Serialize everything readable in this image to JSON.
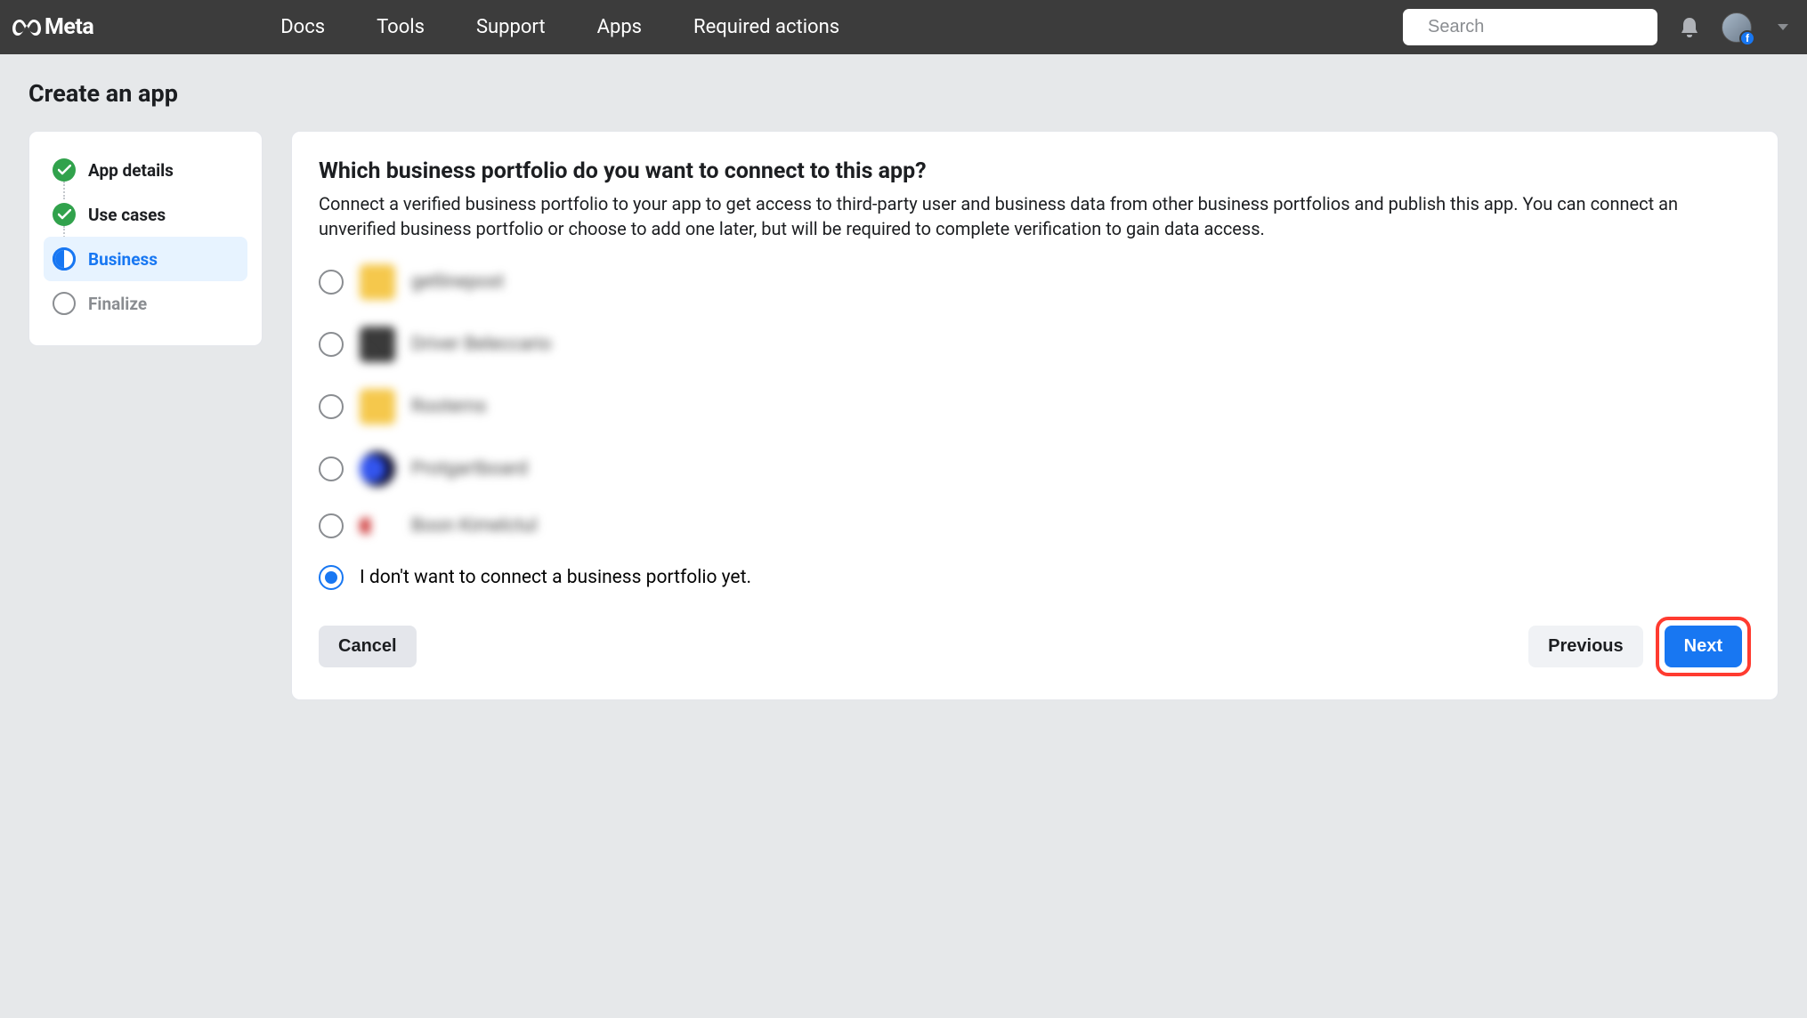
{
  "header": {
    "brand": "Meta",
    "nav": {
      "docs": "Docs",
      "tools": "Tools",
      "support": "Support",
      "apps": "Apps",
      "required_actions": "Required actions"
    },
    "search_placeholder": "Search"
  },
  "page": {
    "title": "Create an app"
  },
  "steps": {
    "app_details": "App details",
    "use_cases": "Use cases",
    "business": "Business",
    "finalize": "Finalize"
  },
  "main": {
    "heading": "Which business portfolio do you want to connect to this app?",
    "description": "Connect a verified business portfolio to your app to get access to third-party user and business data from other business portfolios and publish this app. You can connect an unverified business portfolio or choose to add one later, but will be required to complete verification to gain data access.",
    "options": [
      {
        "label": "getlinepost",
        "selected": false,
        "blurred": true,
        "icon": "c1"
      },
      {
        "label": "Driver Beleccario",
        "selected": false,
        "blurred": true,
        "icon": "c2"
      },
      {
        "label": "Rooterns",
        "selected": false,
        "blurred": true,
        "icon": "c3"
      },
      {
        "label": "Protgartboard",
        "selected": false,
        "blurred": true,
        "icon": "c4"
      },
      {
        "label": "Boon Kimelctul",
        "selected": false,
        "blurred": true,
        "icon": "c5"
      }
    ],
    "no_connect_option": "I don't want to connect a business portfolio yet.",
    "buttons": {
      "cancel": "Cancel",
      "previous": "Previous",
      "next": "Next"
    }
  }
}
